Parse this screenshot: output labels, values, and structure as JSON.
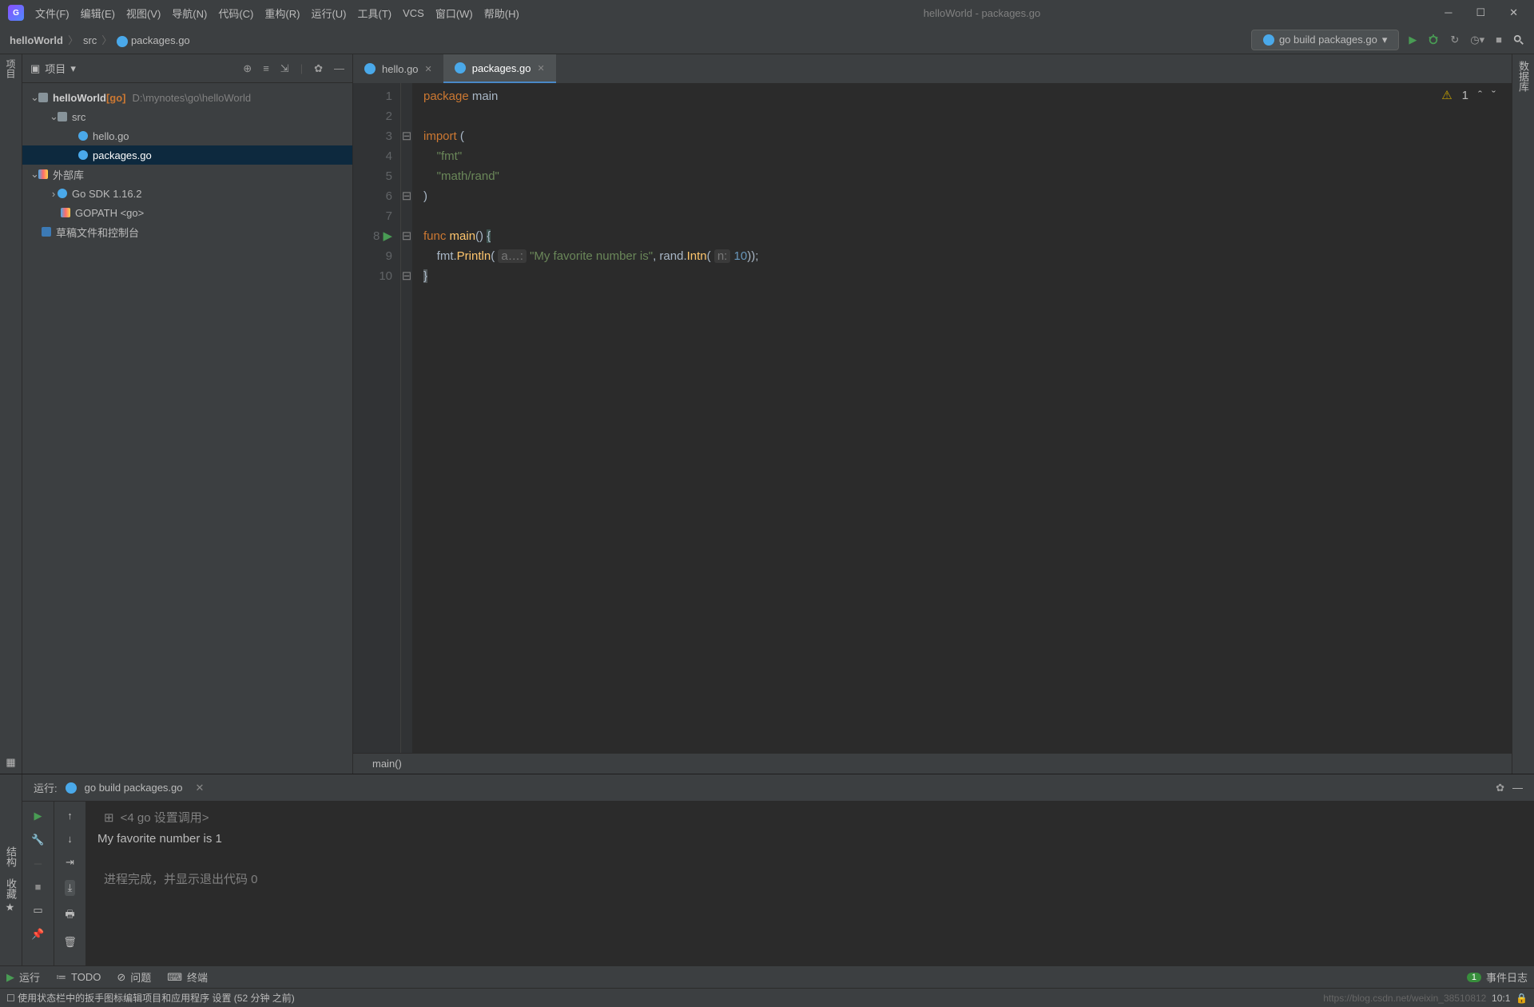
{
  "titlebar": {
    "title": "helloWorld - packages.go"
  },
  "menu": [
    "文件(F)",
    "编辑(E)",
    "视图(V)",
    "导航(N)",
    "代码(C)",
    "重构(R)",
    "运行(U)",
    "工具(T)",
    "VCS",
    "窗口(W)",
    "帮助(H)"
  ],
  "breadcrumb": {
    "root": "helloWorld",
    "p1": "src",
    "p2": "packages.go"
  },
  "runconfig": "go build packages.go",
  "sidebar": {
    "title": "项目",
    "nodes": {
      "root": "helloWorld",
      "rootTag": "[go]",
      "rootPath": "D:\\mynotes\\go\\helloWorld",
      "src": "src",
      "hello": "hello.go",
      "packages": "packages.go",
      "extlib": "外部库",
      "gosdk": "Go SDK 1.16.2",
      "gopath": "GOPATH <go>",
      "scratch": "草稿文件和控制台"
    }
  },
  "tabs": {
    "t1": "hello.go",
    "t2": "packages.go"
  },
  "editor": {
    "warnCount": "1",
    "code": {
      "l1a": "package",
      "l1b": " main",
      "l3a": "import",
      "l3b": " (",
      "l4": "\"fmt\"",
      "l5": "\"math/rand\"",
      "l6": ")",
      "l8a": "func ",
      "l8b": "main",
      "l8c": "() ",
      "l8d": "{",
      "l9a": "    fmt.",
      "l9b": "Println",
      "l9c": "( ",
      "l9h1": "a…:",
      "l9d": " ",
      "l9s": "\"My favorite number is\"",
      "l9e": ", rand.",
      "l9f": "Intn",
      "l9g": "( ",
      "l9h2": "n:",
      "l9n": " 10",
      "l9i": "));",
      "l10": "}"
    },
    "crumb": "main()"
  },
  "runpanel": {
    "title": "运行:",
    "cfg": "go build packages.go",
    "hdr": "<4 go 设置调用>",
    "out1": "My favorite number is 1",
    "out2": "进程完成，并显示退出代码 0"
  },
  "bottomTabs": {
    "run": "运行",
    "todo": "TODO",
    "problems": "问题",
    "terminal": "终端",
    "events": "事件日志",
    "evCount": "1"
  },
  "statusbar": {
    "msg": "使用状态栏中的扳手图标编辑项目和应用程序 设置 (52 分钟 之前)",
    "pos": "10:1",
    "url": "https://blog.csdn.net/weixin_38510812"
  }
}
